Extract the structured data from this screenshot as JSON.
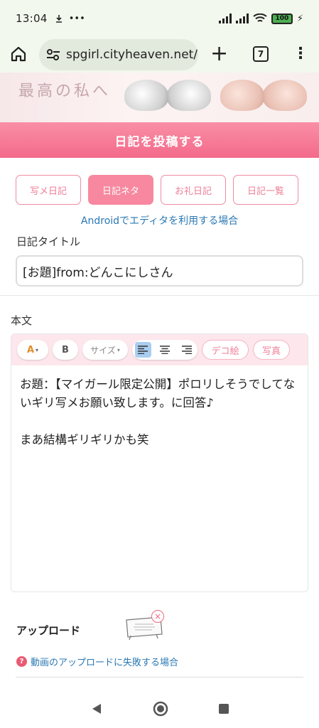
{
  "status_bar": {
    "time": "13:04",
    "battery": "100"
  },
  "browser": {
    "url": "spgirl.cityheaven.net/",
    "tab_count": "7"
  },
  "banner": {
    "text": "最高の私へ"
  },
  "page": {
    "header": "日記を投稿する"
  },
  "tabs": [
    {
      "label": "写メ日記"
    },
    {
      "label": "日記ネタ"
    },
    {
      "label": "お礼日記"
    },
    {
      "label": "日記一覧"
    }
  ],
  "android_link": "Androidでエディタを利用する場合",
  "title_field": {
    "label": "日記タイトル",
    "value": "[お題]from:どんこにしさん"
  },
  "body_field": {
    "label": "本文",
    "toolbar": {
      "bold": "B",
      "size": "サイズ",
      "deco": "デコ絵",
      "photo": "写真"
    },
    "lines": [
      "お題：【マイガール限定公開】ポロリしそうでしてないギリ写メお願い致します。に回答♪",
      "",
      "まあ結構ギリギリかも笑"
    ]
  },
  "upload": {
    "label": "アップロード",
    "help_link": "動画のアップロードに失敗する場合"
  },
  "icons": [
    "home-icon",
    "tune-icon",
    "plus-icon",
    "tabs-icon",
    "menu-icon",
    "back-icon",
    "home-circle-icon",
    "recents-icon"
  ],
  "colors": {
    "accent": "#f36a8a",
    "link": "#2a78b3"
  }
}
